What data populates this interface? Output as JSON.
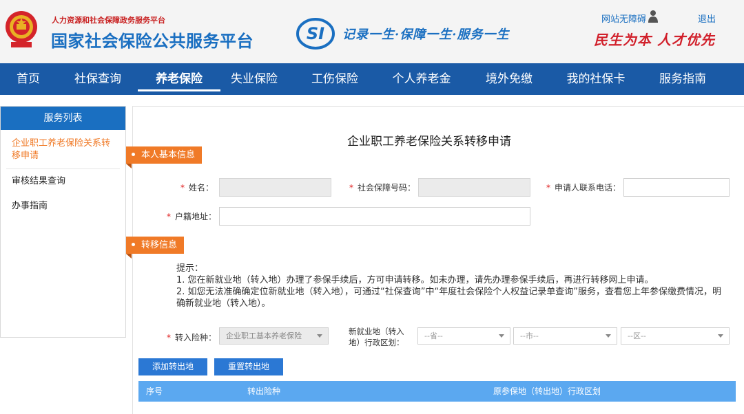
{
  "header": {
    "sub_title": "人力资源和社会保障政务服务平台",
    "main_title": "国家社会保险公共服务平台",
    "logo_text": "SI",
    "slogan": "记录一生·保障一生·服务一生",
    "accessible_link": "网站无障碍",
    "logout": "退出",
    "motto": "民生为本 人才优先"
  },
  "nav": {
    "items": [
      {
        "label": "首页"
      },
      {
        "label": "社保查询"
      },
      {
        "label": "养老保险"
      },
      {
        "label": "失业保险"
      },
      {
        "label": "工伤保险"
      },
      {
        "label": "个人养老金"
      },
      {
        "label": "境外免缴"
      },
      {
        "label": "我的社保卡"
      },
      {
        "label": "服务指南"
      }
    ],
    "active_index": 2
  },
  "sidebar": {
    "title": "服务列表",
    "items": [
      {
        "label": "企业职工养老保险关系转移申请"
      },
      {
        "label": "审核结果查询"
      },
      {
        "label": "办事指南"
      }
    ]
  },
  "form": {
    "title": "企业职工养老保险关系转移申请",
    "section1": "本人基本信息",
    "name_label": "姓名：",
    "ssn_label": "社会保障号码：",
    "phone_label": "申请人联系电话：",
    "address_label": "户籍地址：",
    "name_value": "",
    "ssn_value": "",
    "phone_value": "",
    "address_value": "",
    "section2": "转移信息",
    "tips": [
      "提示：",
      "1. 您在新就业地（转入地）办理了参保手续后，方可申请转移。如未办理，请先办理参保手续后，再进行转移网上申请。",
      "2. 如您无法准确确定位新就业地（转入地），可通过“社保查询”中“年度社会保险个人权益记录单查询”服务，查看您上年参保缴费情况，明确新就业地（转入地）。"
    ],
    "insurance_type_label": "转入险种：",
    "insurance_type_value": "企业职工基本养老保险",
    "region_label_line1": "新就业地（转入",
    "region_label_line2": "地）行政区划：",
    "province_placeholder": "--省--",
    "city_placeholder": "--市--",
    "district_placeholder": "--区--",
    "add_button": "添加转出地",
    "reset_button": "重置转出地",
    "table_headers": [
      "序号",
      "转出险种",
      "原参保地（转出地）行政区划"
    ]
  },
  "colors": {
    "nav_bg": "#1a5aa6",
    "brand_blue": "#1a6fc1",
    "accent_orange": "#f07a27",
    "table_head": "#5ba8f0",
    "button_blue": "#2b78d4"
  }
}
